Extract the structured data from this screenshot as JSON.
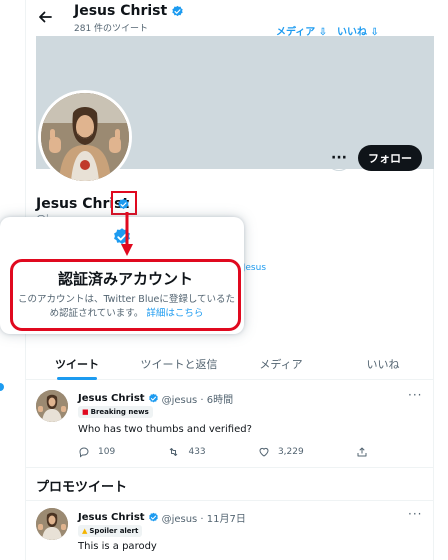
{
  "header": {
    "name": "Jesus Christ",
    "tweet_count": "281 件のツイート",
    "annot_media": "メディア ⇩",
    "annot_likes": "いいね ⇩"
  },
  "profile": {
    "name": "Jesus Christ",
    "handle": "@j",
    "link_fragment": "ki/Jesus",
    "more_label": "···",
    "follow_label": "フォロー"
  },
  "popup": {
    "title": "認証済みアカウント",
    "body": "このアカウントは、Twitter Blueに登録しているため認証されています。",
    "more_link": "詳細はこちら"
  },
  "tabs": [
    "ツイート",
    "ツイートと返信",
    "メディア",
    "いいね"
  ],
  "tweets": [
    {
      "name": "Jesus Christ",
      "meta": "@jesus · 6時間",
      "tag": "Breaking news",
      "text": "Who has two thumbs and verified?",
      "replies": "109",
      "retweets": "433",
      "likes": "3,229"
    },
    {
      "name": "Jesus Christ",
      "meta": "@jesus · 11月7日",
      "tag": "Spoiler alert",
      "text": "This is a parody"
    }
  ],
  "promo_title": "プロモツイート",
  "colors": {
    "accent": "#1d9bf0",
    "highlight_red": "#e0091f",
    "text_primary": "#0f1419",
    "text_secondary": "#536471"
  }
}
